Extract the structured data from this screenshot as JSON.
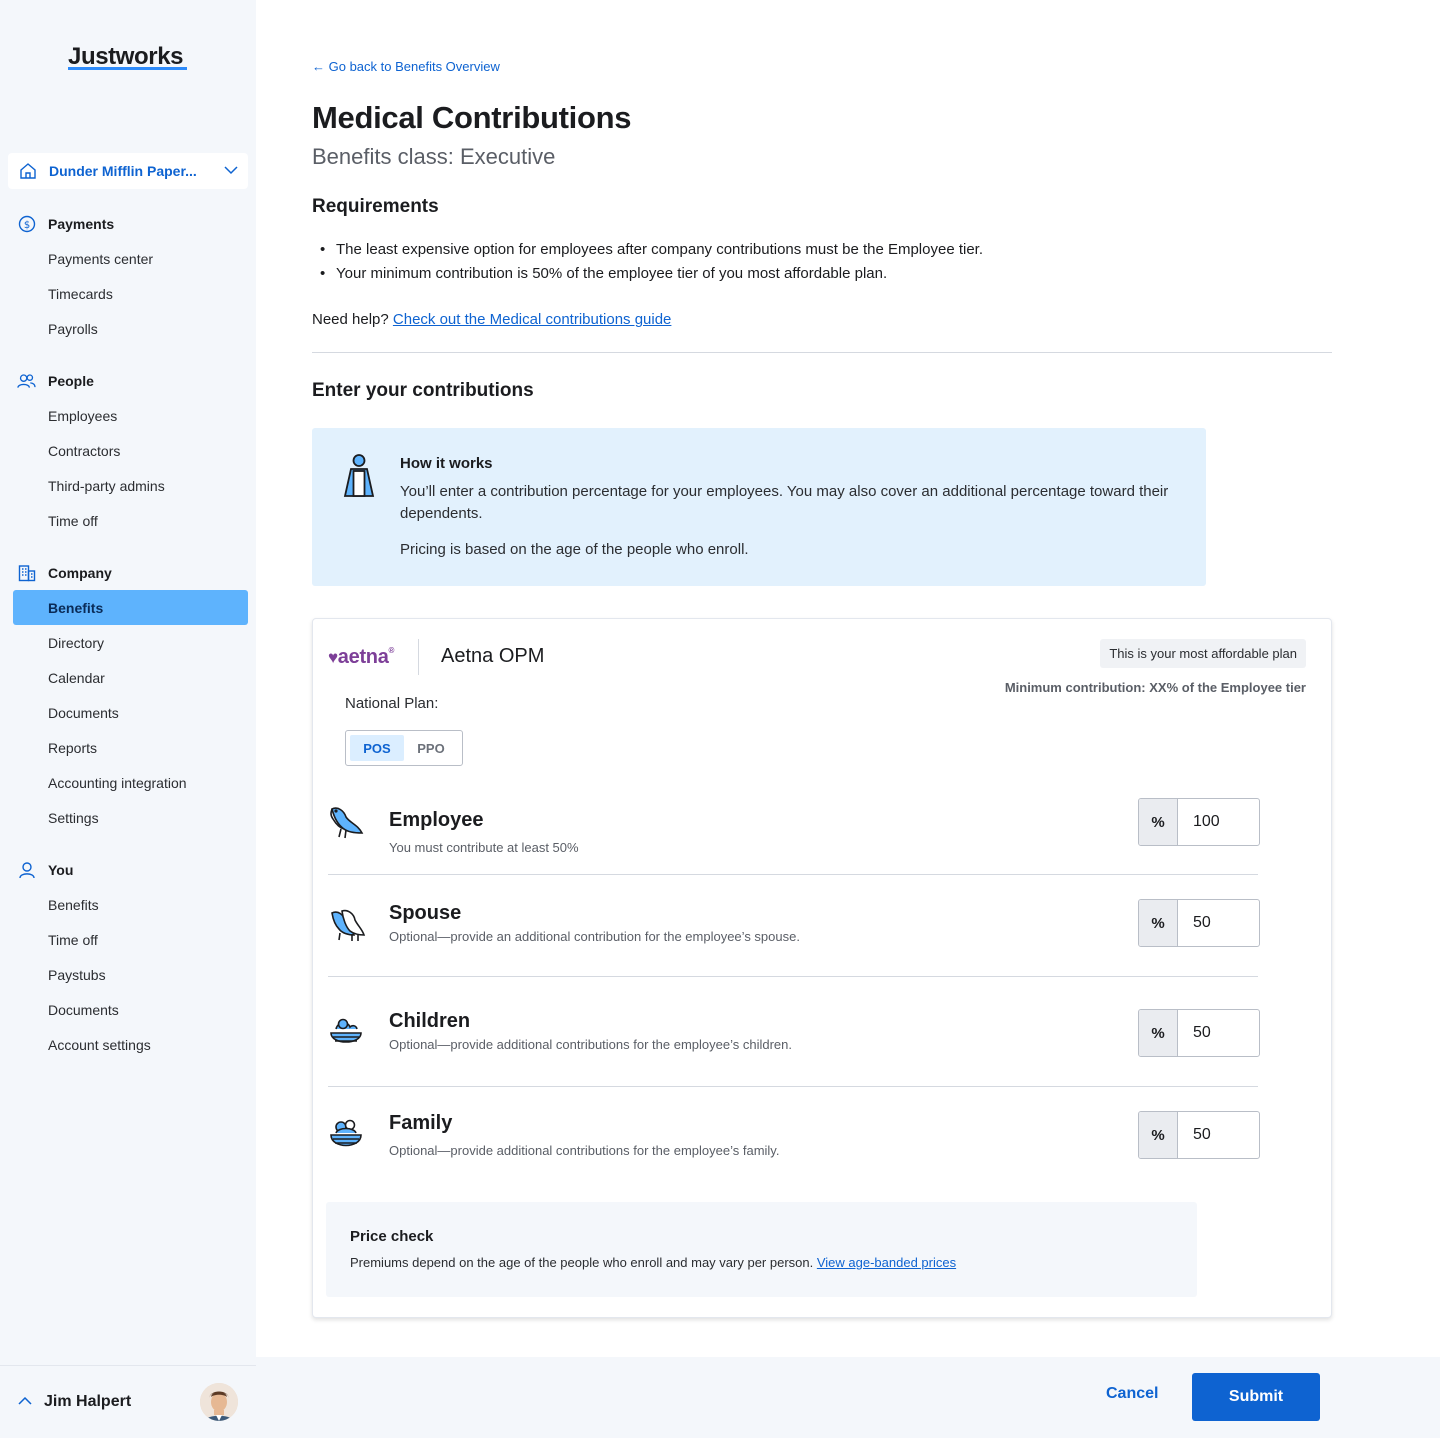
{
  "brand": {
    "name": "Justworks",
    "accent": "#0e63d1",
    "highlight": "#5eb3fd"
  },
  "sidebar": {
    "company_name": "Dunder Mifflin Paper...",
    "sections": [
      {
        "title": "Payments",
        "icon": "dollar-circle-icon",
        "items": [
          "Payments center",
          "Timecards",
          "Payrolls"
        ]
      },
      {
        "title": "People",
        "icon": "people-icon",
        "items": [
          "Employees",
          "Contractors",
          "Third-party admins",
          "Time off"
        ]
      },
      {
        "title": "Company",
        "icon": "building-icon",
        "items": [
          "Benefits",
          "Directory",
          "Calendar",
          "Documents",
          "Reports",
          "Accounting integration",
          "Settings"
        ],
        "active": "Benefits"
      },
      {
        "title": "You",
        "icon": "user-icon",
        "items": [
          "Benefits",
          "Time off",
          "Paystubs",
          "Documents",
          "Account settings"
        ]
      }
    ],
    "user_name": "Jim Halpert"
  },
  "main": {
    "back_link": "← Go back to Benefits Overview",
    "title": "Medical Contributions",
    "subtitle": "Benefits class: Executive",
    "requirements_title": "Requirements",
    "requirements": [
      "The least expensive option for employees after company contributions must be the Employee tier.",
      "Your minimum contribution is 50% of the employee tier of you most affordable plan."
    ],
    "help_prefix": "Need help?",
    "help_link": "Check out the Medical contributions guide",
    "enter_title": "Enter your contributions",
    "info": {
      "title": "How it works",
      "p1": "You’ll enter a contribution percentage for your employees. You may also cover an additional percentage toward their dependents.",
      "p2": "Pricing is based on the age of the people who enroll."
    },
    "plan": {
      "carrier_logo": "aetna",
      "name": "Aetna OPM",
      "affordable_badge": "This is your most affordable plan",
      "min_contribution": "Minimum contribution: XX% of the Employee tier",
      "national_label": "National Plan:",
      "options": [
        "POS",
        "PPO"
      ],
      "selected": "POS",
      "tiers": [
        {
          "name": "Employee",
          "desc": "You must contribute at least 50%",
          "symbol": "%",
          "value": "100"
        },
        {
          "name": "Spouse",
          "desc": "Optional—provide an additional contribution for the employee’s spouse.",
          "symbol": "%",
          "value": "50"
        },
        {
          "name": "Children",
          "desc": "Optional—provide additional contributions for the employee’s children.",
          "symbol": "%",
          "value": "50"
        },
        {
          "name": "Family",
          "desc": "Optional—provide additional contributions for the employee’s family.",
          "symbol": "%",
          "value": "50"
        }
      ],
      "price_check": {
        "title": "Price check",
        "text": "Premiums depend on the age of the people who enroll and may vary per person.",
        "link": "View age-banded prices"
      }
    }
  },
  "footer": {
    "cancel": "Cancel",
    "submit": "Submit"
  }
}
